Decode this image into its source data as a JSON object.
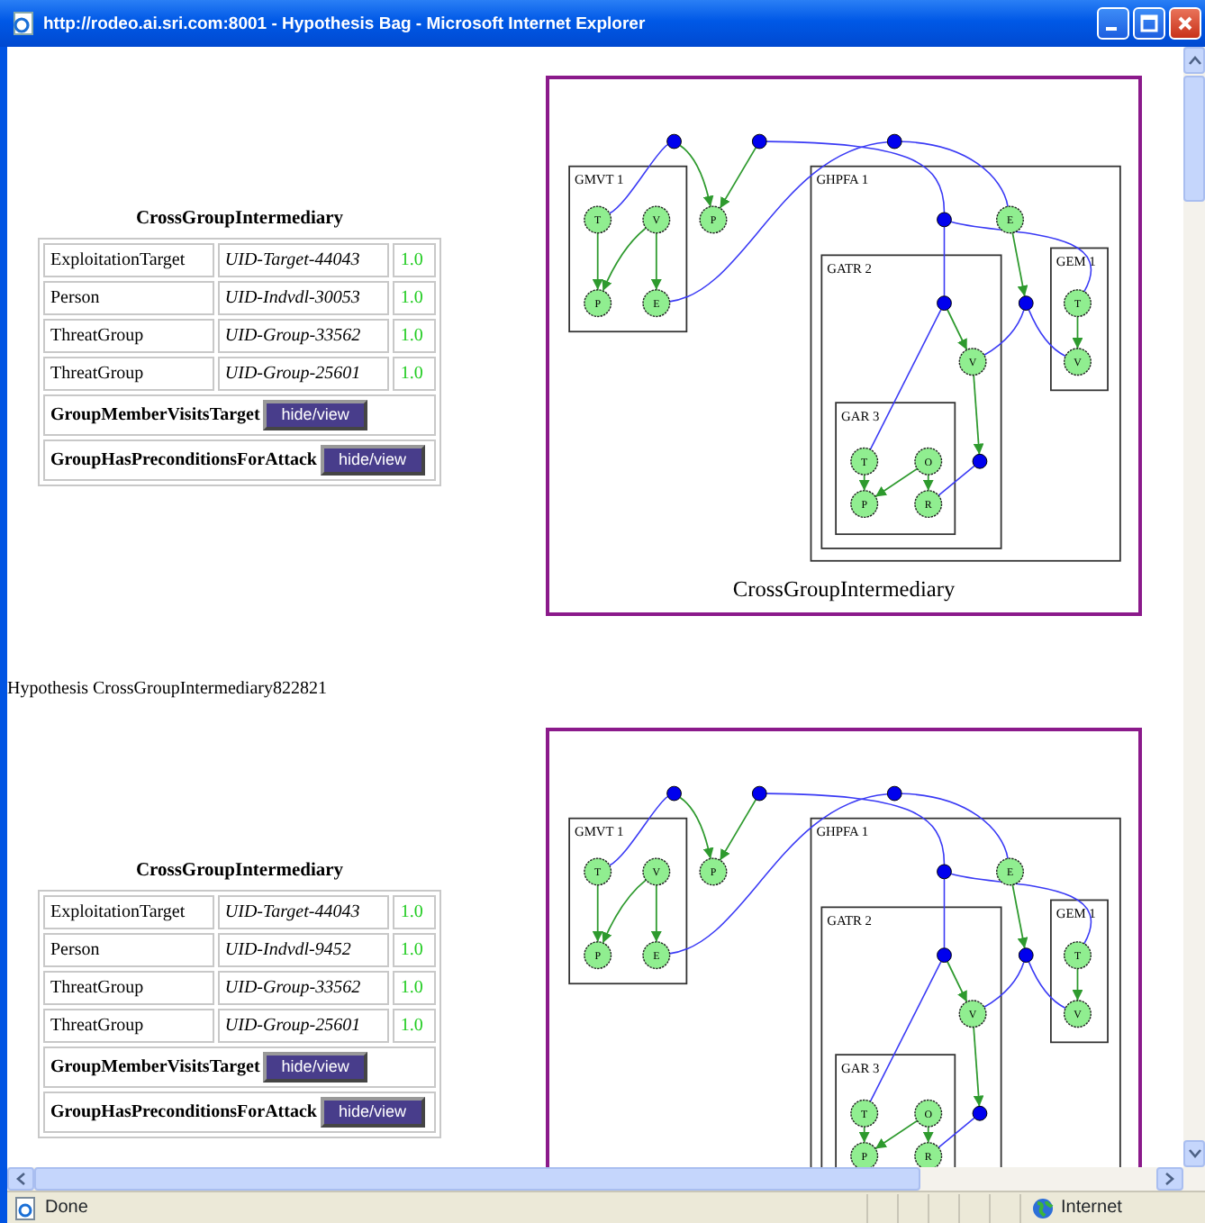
{
  "window": {
    "title": "http://rodeo.ai.sri.com:8001 - Hypothesis Bag - Microsoft Internet Explorer"
  },
  "hypotheses": [
    {
      "table": {
        "title": "CrossGroupIntermediary",
        "rows": [
          {
            "type": "ExploitationTarget",
            "uid": "UID-Target-44043",
            "score": "1.0"
          },
          {
            "type": "Person",
            "uid": "UID-Indvdl-30053",
            "score": "1.0"
          },
          {
            "type": "ThreatGroup",
            "uid": "UID-Group-33562",
            "score": "1.0"
          },
          {
            "type": "ThreatGroup",
            "uid": "UID-Group-25601",
            "score": "1.0"
          }
        ],
        "sections": [
          {
            "label": "GroupMemberVisitsTarget",
            "button": "hide/view"
          },
          {
            "label": "GroupHasPreconditionsForAttack",
            "button": "hide/view"
          }
        ]
      },
      "graph": {
        "caption": "CrossGroupIntermediary",
        "clusters": [
          {
            "label": "GMVT 1"
          },
          {
            "label": "GHPFA 1"
          },
          {
            "label": "GATR 2"
          },
          {
            "label": "GAR 3"
          },
          {
            "label": "GEM 1"
          }
        ],
        "nodes": [
          {
            "label": "T"
          },
          {
            "label": "V"
          },
          {
            "label": "P"
          },
          {
            "label": "E"
          },
          {
            "label": "P"
          },
          {
            "label": "E"
          },
          {
            "label": "T"
          },
          {
            "label": "V"
          },
          {
            "label": "V"
          },
          {
            "label": "T"
          },
          {
            "label": "O"
          },
          {
            "label": "P"
          },
          {
            "label": "R"
          }
        ]
      }
    },
    {
      "heading": "Hypothesis CrossGroupIntermediary822821",
      "table": {
        "title": "CrossGroupIntermediary",
        "rows": [
          {
            "type": "ExploitationTarget",
            "uid": "UID-Target-44043",
            "score": "1.0"
          },
          {
            "type": "Person",
            "uid": "UID-Indvdl-9452",
            "score": "1.0"
          },
          {
            "type": "ThreatGroup",
            "uid": "UID-Group-33562",
            "score": "1.0"
          },
          {
            "type": "ThreatGroup",
            "uid": "UID-Group-25601",
            "score": "1.0"
          }
        ],
        "sections": [
          {
            "label": "GroupMemberVisitsTarget",
            "button": "hide/view"
          },
          {
            "label": "GroupHasPreconditionsForAttack",
            "button": "hide/view"
          }
        ]
      },
      "graph": {
        "clusters": [
          {
            "label": "GMVT 1"
          },
          {
            "label": "GHPFA 1"
          },
          {
            "label": "GATR 2"
          },
          {
            "label": "GAR 3"
          },
          {
            "label": "GEM 1"
          }
        ],
        "nodes": [
          {
            "label": "T"
          },
          {
            "label": "V"
          },
          {
            "label": "P"
          },
          {
            "label": "E"
          },
          {
            "label": "P"
          },
          {
            "label": "E"
          },
          {
            "label": "T"
          },
          {
            "label": "V"
          },
          {
            "label": "V"
          },
          {
            "label": "T"
          },
          {
            "label": "O"
          },
          {
            "label": "P"
          },
          {
            "label": "R"
          }
        ]
      }
    }
  ],
  "status_bar": {
    "text": "Done",
    "zone": "Internet"
  }
}
